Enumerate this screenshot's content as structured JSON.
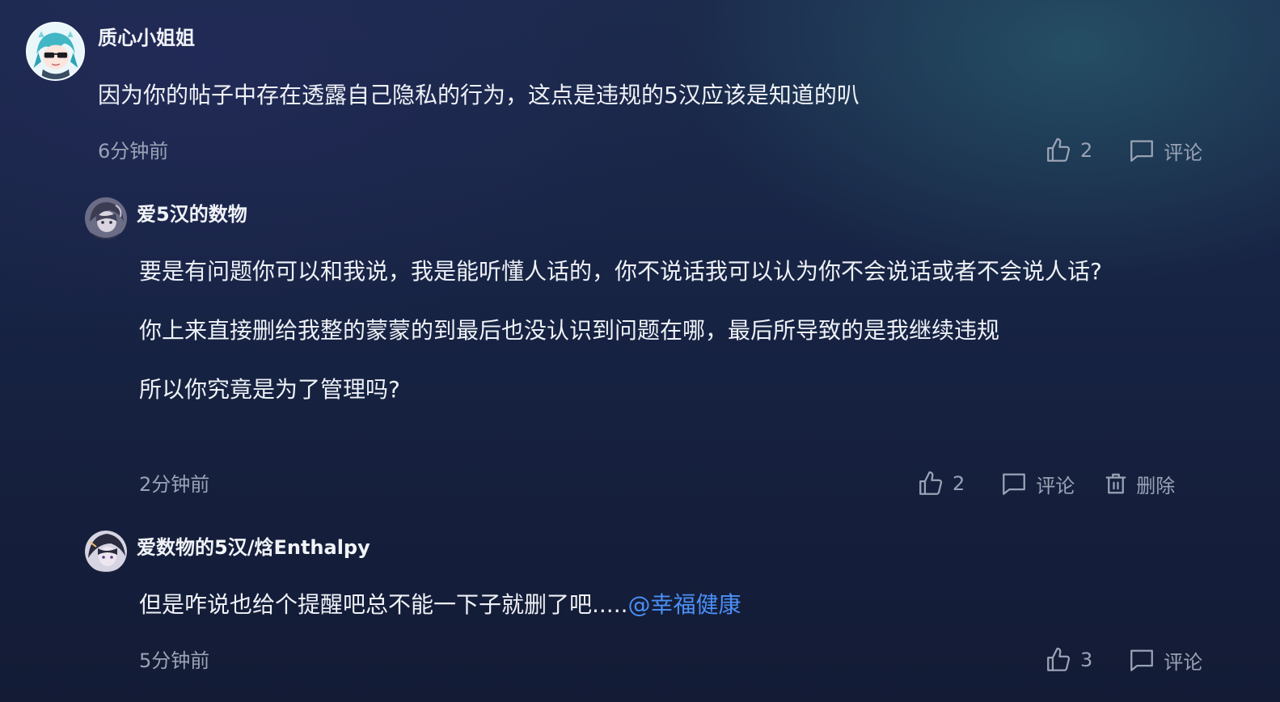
{
  "comments": [
    {
      "user": "质心小姐姐",
      "avatar_icon": "anime-girl-sunglasses-avatar",
      "text": [
        "因为你的帖子中存在透露自己隐私的行为，这点是违规的5汉应该是知道的叭"
      ],
      "time": "6分钟前",
      "likes": "2",
      "comment_label": "评论"
    },
    {
      "user": "爱5汉的数物",
      "avatar_icon": "anime-character-avatar",
      "text": [
        "要是有问题你可以和我说，我是能听懂人话的，你不说话我可以认为你不会说话或者不会说人话?",
        "你上来直接删给我整的蒙蒙的到最后也没认识到问题在哪，最后所导致的是我继续违规",
        "所以你究竟是为了管理吗?"
      ],
      "time": "2分钟前",
      "likes": "2",
      "comment_label": "评论",
      "delete_label": "删除"
    },
    {
      "user": "爱数物的5汉/焓Enthalpy",
      "avatar_icon": "anime-character-avatar",
      "text": "但是咋说也给个提醒吧总不能一下子就删了吧.....",
      "mention": "@幸福健康",
      "time": "5分钟前",
      "likes": "3",
      "comment_label": "评论"
    }
  ],
  "colors": {
    "mention": "#4b8ff5",
    "meta": "#9aa3b5",
    "text": "#eef1f6"
  }
}
